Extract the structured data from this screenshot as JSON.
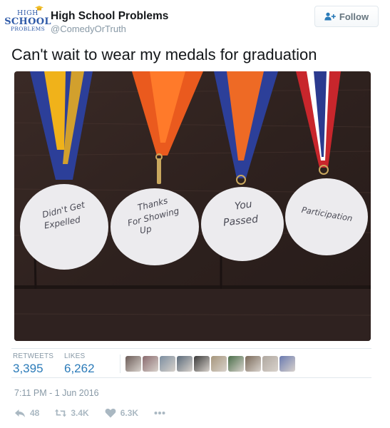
{
  "account": {
    "name": "High School Problems",
    "handle": "@ComedyOrTruth",
    "avatar_lines": [
      "HIGH",
      "SCHOOL",
      "PROBLEMS"
    ]
  },
  "follow_button": {
    "label": "Follow",
    "icon": "add-user-icon"
  },
  "tweet": {
    "text": "Can't wait to wear my medals for graduation",
    "photo": {
      "medals": [
        {
          "lines": [
            "Didn't Get",
            "Expelled"
          ],
          "ribbon": [
            "#2c3f99",
            "#f0b21a"
          ]
        },
        {
          "lines": [
            "Thanks",
            "For Showing",
            "Up"
          ],
          "ribbon": [
            "#ea5a1e",
            "#ff7a2a"
          ]
        },
        {
          "lines": [
            "You",
            "Passed"
          ],
          "ribbon": [
            "#2c3f99",
            "#ee6a25"
          ]
        },
        {
          "lines": [
            "Participation"
          ],
          "ribbon": [
            "#c8262c",
            "#ffffff",
            "#2b3a8f"
          ]
        }
      ]
    }
  },
  "stats": {
    "retweets_label": "RETWEETS",
    "retweets_value": "3,395",
    "likes_label": "LIKES",
    "likes_value": "6,262"
  },
  "likers": [
    "#6b5b57",
    "#8a6a6e",
    "#7c8ea0",
    "#5a6a7a",
    "#3a3a3a",
    "#a6967c",
    "#4a6e4a",
    "#7a6a5a",
    "#b0a8a0",
    "#6a7ab0"
  ],
  "timestamp": "7:11 PM - 1 Jun 2016",
  "actions": {
    "reply_count": "48",
    "retweet_count": "3.4K",
    "like_count": "6.3K"
  },
  "colors": {
    "link_blue": "#2b7bb9",
    "muted_gray": "#8899a6",
    "action_gray": "#aab8c2"
  }
}
